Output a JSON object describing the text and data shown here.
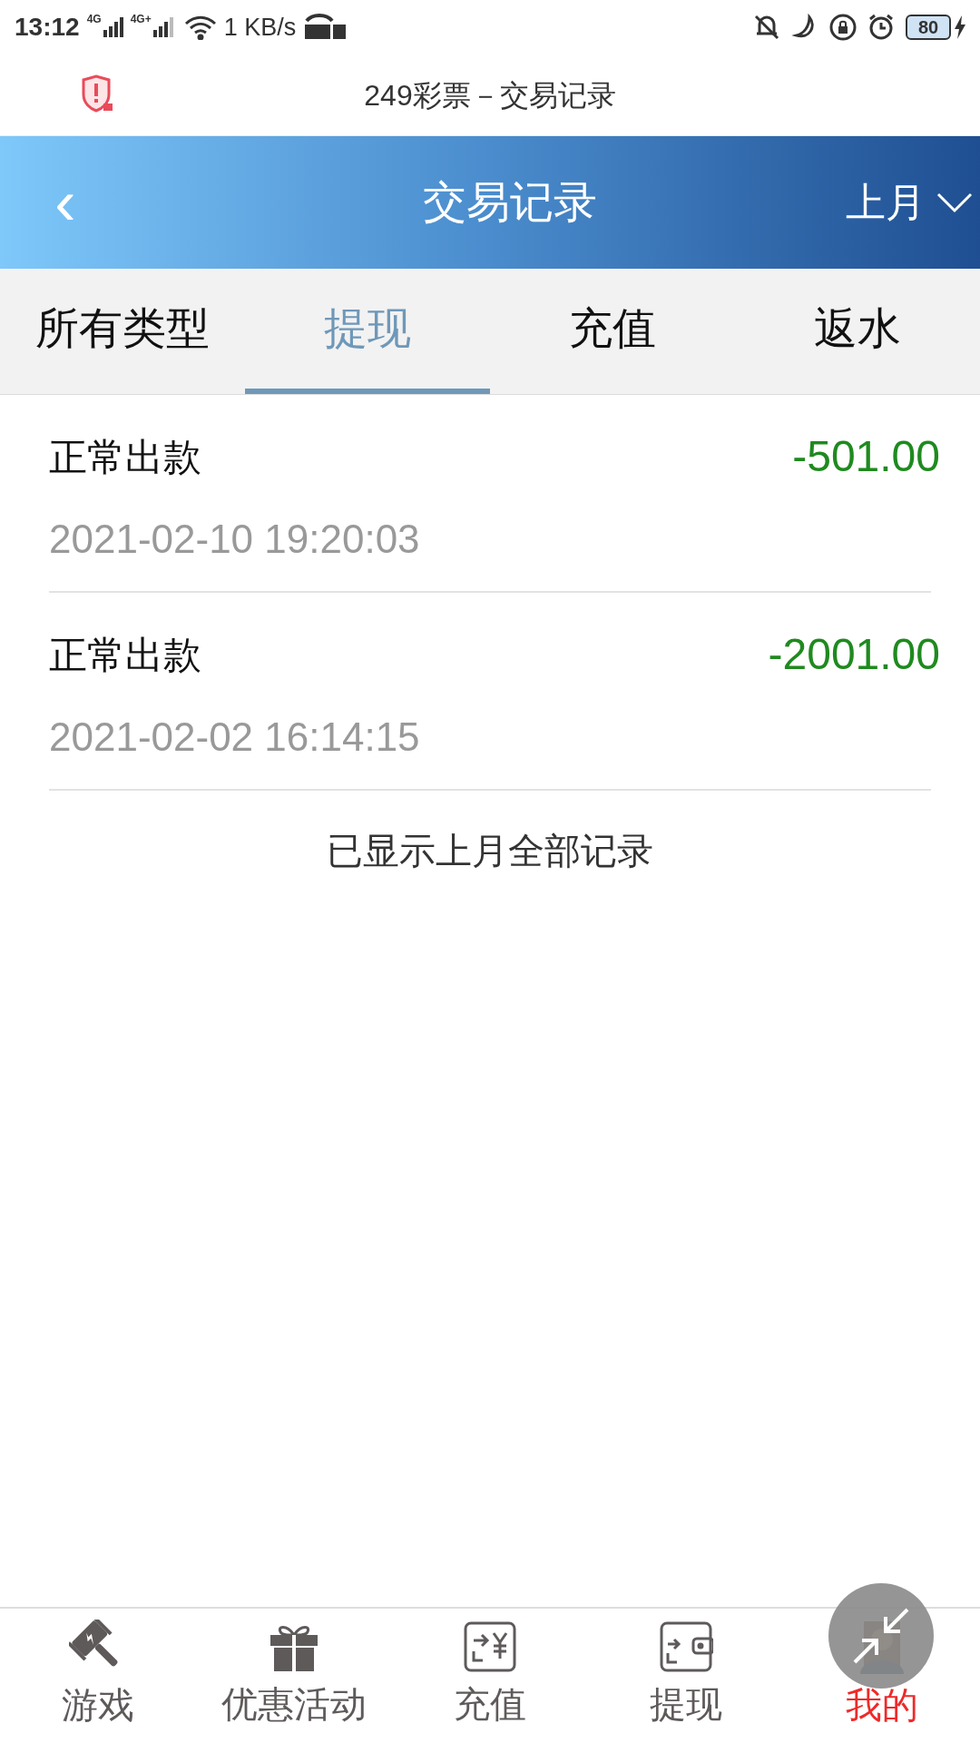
{
  "status_bar": {
    "time": "13:12",
    "signal_1": "4G",
    "signal_2": "4G+",
    "speed": "1 KB/s",
    "battery": "80"
  },
  "browser_title": "249彩票－交易记录",
  "header": {
    "back": "‹",
    "title": "交易记录",
    "period": "上月"
  },
  "tabs": [
    {
      "label": "所有类型",
      "selected": false
    },
    {
      "label": "提现",
      "selected": true
    },
    {
      "label": "充值",
      "selected": false
    },
    {
      "label": "返水",
      "selected": false
    }
  ],
  "records": [
    {
      "type": "正常出款",
      "amount": "-501.00",
      "time": "2021-02-10 19:20:03"
    },
    {
      "type": "正常出款",
      "amount": "-2001.00",
      "time": "2021-02-02 16:14:15"
    }
  ],
  "end_note": "已显示上月全部记录",
  "bottom_nav": [
    {
      "label": "游戏",
      "kind": "game",
      "selected": false
    },
    {
      "label": "优惠活动",
      "kind": "gift",
      "selected": false
    },
    {
      "label": "充值",
      "kind": "recharge",
      "selected": false
    },
    {
      "label": "提现",
      "kind": "withdraw",
      "selected": false
    },
    {
      "label": "我的",
      "kind": "profile",
      "selected": true
    }
  ]
}
